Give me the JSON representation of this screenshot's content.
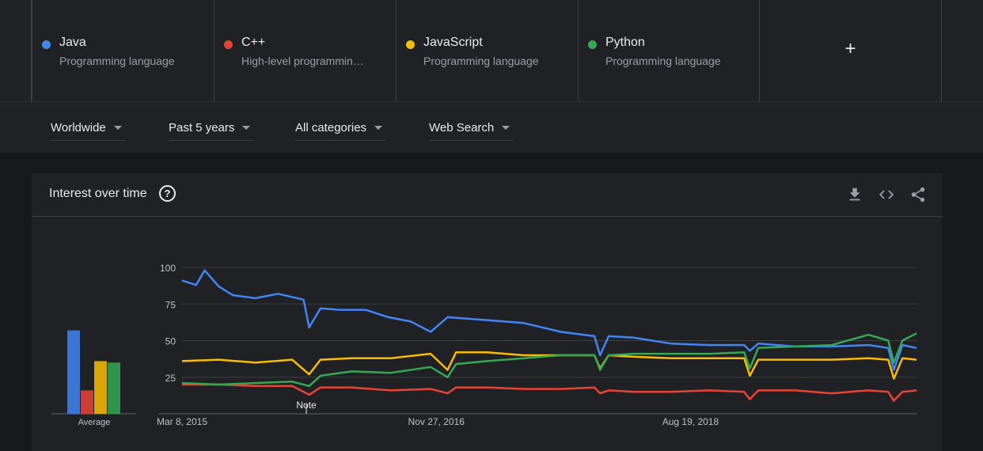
{
  "terms": [
    {
      "name": "Java",
      "subtitle": "Programming language",
      "color": "#4285f4"
    },
    {
      "name": "C++",
      "subtitle": "High-level programmin…",
      "color": "#ea4335"
    },
    {
      "name": "JavaScript",
      "subtitle": "Programming language",
      "color": "#fbbc04"
    },
    {
      "name": "Python",
      "subtitle": "Programming language",
      "color": "#34a853"
    }
  ],
  "add_term_label": "+",
  "filters": {
    "region": "Worldwide",
    "time": "Past 5 years",
    "category": "All categories",
    "property": "Web Search"
  },
  "card": {
    "title": "Interest over time",
    "help_icon": "help-circle-icon",
    "actions": [
      "download-icon",
      "embed-code-icon",
      "share-icon"
    ]
  },
  "chart_data": {
    "type": "line",
    "y_ticks": [
      25,
      50,
      75,
      100
    ],
    "ylim": [
      0,
      100
    ],
    "x_tick_labels": [
      "Mar 8, 2015",
      "Nov 27, 2016",
      "Aug 19, 2018"
    ],
    "x_range": [
      "2015-03-08",
      "2020-03-01"
    ],
    "note_label": "Note",
    "note_date": "2016-01-10",
    "average_label": "Average",
    "averages": [
      {
        "name": "Java",
        "value": 57
      },
      {
        "name": "C++",
        "value": 16
      },
      {
        "name": "JavaScript",
        "value": 36
      },
      {
        "name": "Python",
        "value": 35
      }
    ],
    "series": [
      {
        "name": "Java",
        "color": "#4285f4",
        "points": [
          [
            "2015-03-08",
            91
          ],
          [
            "2015-04-12",
            88
          ],
          [
            "2015-05-03",
            98
          ],
          [
            "2015-06-07",
            87
          ],
          [
            "2015-07-12",
            81
          ],
          [
            "2015-09-06",
            79
          ],
          [
            "2015-11-01",
            82
          ],
          [
            "2016-01-03",
            78
          ],
          [
            "2016-01-17",
            59
          ],
          [
            "2016-02-14",
            72
          ],
          [
            "2016-04-03",
            71
          ],
          [
            "2016-06-05",
            71
          ],
          [
            "2016-07-31",
            66
          ],
          [
            "2016-09-25",
            63
          ],
          [
            "2016-11-13",
            56
          ],
          [
            "2016-12-25",
            66
          ],
          [
            "2017-04-02",
            64
          ],
          [
            "2017-07-02",
            62
          ],
          [
            "2017-10-01",
            56
          ],
          [
            "2017-12-24",
            53
          ],
          [
            "2018-01-07",
            40
          ],
          [
            "2018-01-28",
            53
          ],
          [
            "2018-04-01",
            52
          ],
          [
            "2018-07-01",
            48
          ],
          [
            "2018-10-07",
            47
          ],
          [
            "2018-12-30",
            47
          ],
          [
            "2019-01-13",
            43
          ],
          [
            "2019-02-03",
            48
          ],
          [
            "2019-05-05",
            46
          ],
          [
            "2019-08-04",
            46
          ],
          [
            "2019-11-03",
            47
          ],
          [
            "2019-12-22",
            45
          ],
          [
            "2020-01-05",
            30
          ],
          [
            "2020-01-26",
            47
          ],
          [
            "2020-03-01",
            45
          ]
        ]
      },
      {
        "name": "C++",
        "color": "#ea4335",
        "points": [
          [
            "2015-03-08",
            20
          ],
          [
            "2015-06-07",
            20
          ],
          [
            "2015-09-06",
            19
          ],
          [
            "2015-12-06",
            19
          ],
          [
            "2016-01-17",
            13
          ],
          [
            "2016-02-14",
            18
          ],
          [
            "2016-05-01",
            18
          ],
          [
            "2016-08-07",
            16
          ],
          [
            "2016-11-13",
            17
          ],
          [
            "2016-12-25",
            14
          ],
          [
            "2017-01-15",
            18
          ],
          [
            "2017-04-02",
            18
          ],
          [
            "2017-07-02",
            17
          ],
          [
            "2017-10-01",
            17
          ],
          [
            "2017-12-24",
            18
          ],
          [
            "2018-01-07",
            14
          ],
          [
            "2018-01-28",
            16
          ],
          [
            "2018-04-01",
            15
          ],
          [
            "2018-07-01",
            15
          ],
          [
            "2018-10-07",
            16
          ],
          [
            "2018-12-30",
            15
          ],
          [
            "2019-01-13",
            10
          ],
          [
            "2019-02-03",
            16
          ],
          [
            "2019-05-05",
            16
          ],
          [
            "2019-08-04",
            14
          ],
          [
            "2019-11-03",
            16
          ],
          [
            "2019-12-22",
            15
          ],
          [
            "2020-01-05",
            9
          ],
          [
            "2020-01-26",
            15
          ],
          [
            "2020-03-01",
            16
          ]
        ]
      },
      {
        "name": "JavaScript",
        "color": "#fbbc04",
        "points": [
          [
            "2015-03-08",
            36
          ],
          [
            "2015-06-07",
            37
          ],
          [
            "2015-09-06",
            35
          ],
          [
            "2015-12-06",
            37
          ],
          [
            "2016-01-17",
            27
          ],
          [
            "2016-02-14",
            37
          ],
          [
            "2016-05-01",
            38
          ],
          [
            "2016-08-07",
            38
          ],
          [
            "2016-11-13",
            41
          ],
          [
            "2016-12-25",
            30
          ],
          [
            "2017-01-15",
            42
          ],
          [
            "2017-04-02",
            42
          ],
          [
            "2017-07-02",
            40
          ],
          [
            "2017-10-01",
            40
          ],
          [
            "2017-12-24",
            40
          ],
          [
            "2018-01-07",
            31
          ],
          [
            "2018-01-28",
            40
          ],
          [
            "2018-04-01",
            39
          ],
          [
            "2018-07-01",
            38
          ],
          [
            "2018-10-07",
            38
          ],
          [
            "2018-12-30",
            38
          ],
          [
            "2019-01-13",
            26
          ],
          [
            "2019-02-03",
            37
          ],
          [
            "2019-05-05",
            37
          ],
          [
            "2019-08-04",
            37
          ],
          [
            "2019-11-03",
            38
          ],
          [
            "2019-12-22",
            37
          ],
          [
            "2020-01-05",
            24
          ],
          [
            "2020-01-26",
            38
          ],
          [
            "2020-03-01",
            37
          ]
        ]
      },
      {
        "name": "Python",
        "color": "#34a853",
        "points": [
          [
            "2015-03-08",
            21
          ],
          [
            "2015-06-07",
            20
          ],
          [
            "2015-09-06",
            21
          ],
          [
            "2015-12-06",
            22
          ],
          [
            "2016-01-17",
            19
          ],
          [
            "2016-02-14",
            26
          ],
          [
            "2016-05-01",
            29
          ],
          [
            "2016-08-07",
            28
          ],
          [
            "2016-11-13",
            32
          ],
          [
            "2016-12-25",
            25
          ],
          [
            "2017-01-15",
            34
          ],
          [
            "2017-04-02",
            36
          ],
          [
            "2017-07-02",
            38
          ],
          [
            "2017-10-01",
            40
          ],
          [
            "2017-12-24",
            40
          ],
          [
            "2018-01-07",
            30
          ],
          [
            "2018-01-28",
            40
          ],
          [
            "2018-04-01",
            41
          ],
          [
            "2018-07-01",
            41
          ],
          [
            "2018-10-07",
            41
          ],
          [
            "2018-12-30",
            42
          ],
          [
            "2019-01-13",
            31
          ],
          [
            "2019-02-03",
            45
          ],
          [
            "2019-05-05",
            46
          ],
          [
            "2019-08-04",
            47
          ],
          [
            "2019-11-03",
            54
          ],
          [
            "2019-12-22",
            50
          ],
          [
            "2020-01-05",
            35
          ],
          [
            "2020-01-26",
            50
          ],
          [
            "2020-03-01",
            55
          ]
        ]
      }
    ]
  }
}
